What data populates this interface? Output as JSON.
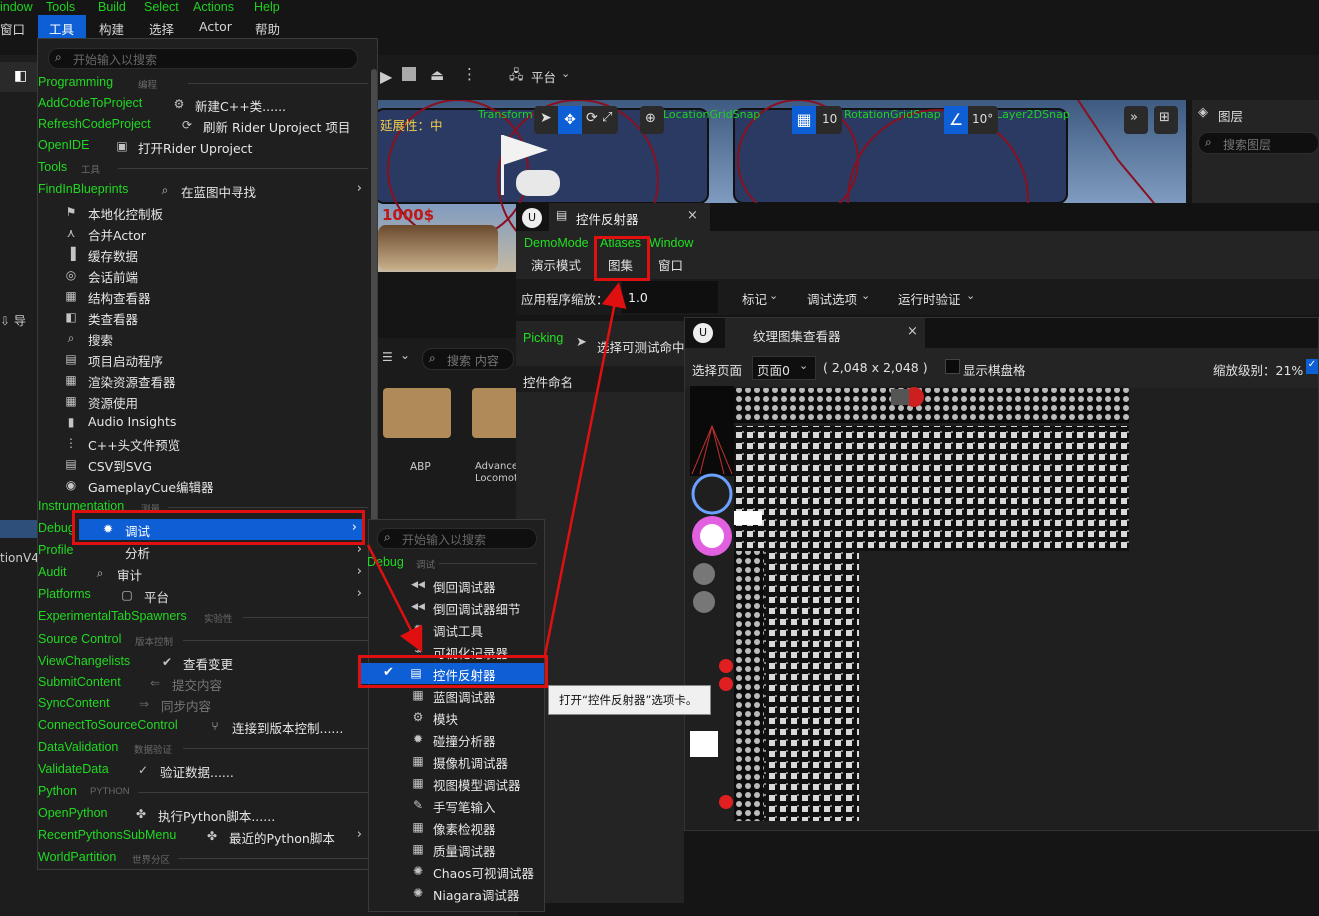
{
  "top_menu": {
    "items": [
      {
        "en": "indow",
        "cn": "窗口"
      },
      {
        "en": "Tools",
        "cn": "工具"
      },
      {
        "en": "Build",
        "cn": "构建"
      },
      {
        "en": "Select",
        "cn": "选择"
      },
      {
        "en": "Actions",
        "cn": "Actor"
      },
      {
        "en": "Help",
        "cn": "帮助"
      }
    ]
  },
  "toolbar": {
    "platform_label": "平台"
  },
  "viewport": {
    "green_labels": [
      "Transform",
      "LocationGridSnap",
      "RotationGridSnap",
      "Layer2DSnap"
    ],
    "snap_value": "10",
    "rot_value": "10°",
    "extensibility": "延展性：中",
    "banner_text": "1000$"
  },
  "layers_panel": {
    "title": "图层",
    "search_placeholder": "搜索图层"
  },
  "content_browser": {
    "search_placeholder": "搜索 内容",
    "folders": [
      "ABP",
      "Advance Locomot"
    ]
  },
  "left_fragments": {
    "import": "导",
    "version": "tionV4"
  },
  "tools_menu": {
    "search_placeholder": "开始输入以搜索",
    "sections": {
      "programming": {
        "en": "Programming",
        "small": "编程"
      },
      "tools": {
        "en": "Tools",
        "small": "工具"
      },
      "instrumentation": {
        "en": "Instrumentation",
        "small": "测量"
      },
      "source_control": {
        "en": "Source Control",
        "small": "版本控制"
      },
      "data_validation": {
        "en": "DataValidation",
        "small": "数据验证"
      },
      "python": {
        "en": "Python",
        "small": "PYTHON"
      },
      "world_partition": {
        "en": "WorldPartition",
        "small": "世界分区"
      },
      "experimental": {
        "en": "ExperimentalTabSpawners",
        "small": "实验性"
      }
    },
    "items": [
      {
        "en": "AddCodeToProject",
        "cn": "新建C++类......",
        "icon": "cpp-class-icon",
        "glyph": "⚙"
      },
      {
        "en": "RefreshCodeProject",
        "cn": "刷新 Rider Uproject 项目",
        "icon": "refresh-icon",
        "glyph": "⟳"
      },
      {
        "en": "OpenIDE",
        "cn": "打开Rider Uproject",
        "icon": "ide-icon",
        "glyph": "▣"
      },
      {
        "en": "FindInBlueprints",
        "cn": "在蓝图中寻找",
        "icon": "search-icon",
        "glyph": "⌕"
      },
      {
        "en": "",
        "cn": "本地化控制板",
        "icon": "flag-icon",
        "glyph": "⚑"
      },
      {
        "en": "",
        "cn": "合并Actor",
        "icon": "merge-icon",
        "glyph": "⋏"
      },
      {
        "en": "",
        "cn": "缓存数据",
        "icon": "chart-icon",
        "glyph": "▐"
      },
      {
        "en": "",
        "cn": "会话前端",
        "icon": "session-icon",
        "glyph": "◎"
      },
      {
        "en": "",
        "cn": "结构查看器",
        "icon": "struct-icon",
        "glyph": "▦"
      },
      {
        "en": "",
        "cn": "类查看器",
        "icon": "class-icon",
        "glyph": "◧"
      },
      {
        "en": "",
        "cn": "搜索",
        "icon": "search-icon",
        "glyph": "⌕"
      },
      {
        "en": "",
        "cn": "项目启动程序",
        "icon": "launcher-icon",
        "glyph": "▤"
      },
      {
        "en": "",
        "cn": "渲染资源查看器",
        "icon": "render-icon",
        "glyph": "▦"
      },
      {
        "en": "",
        "cn": "资源使用",
        "icon": "table-icon",
        "glyph": "▦"
      },
      {
        "en": "",
        "cn": "Audio Insights",
        "icon": "audio-icon",
        "glyph": "▮"
      },
      {
        "en": "",
        "cn": "C++头文件预览",
        "icon": "header-icon",
        "glyph": "⋮"
      },
      {
        "en": "",
        "cn": "CSV到SVG",
        "icon": "csv-icon",
        "glyph": "▤"
      },
      {
        "en": "",
        "cn": "GameplayCue编辑器",
        "icon": "cue-icon",
        "glyph": "◉"
      },
      {
        "en": "Debug",
        "cn": "调试",
        "icon": "debug-icon",
        "glyph": "✹"
      },
      {
        "en": "Profile",
        "cn": "分析",
        "icon": "",
        "glyph": ""
      },
      {
        "en": "Audit",
        "cn": "审计",
        "icon": "audit-icon",
        "glyph": "⌕"
      },
      {
        "en": "Platforms",
        "cn": "平台",
        "icon": "platform-icon",
        "glyph": "▢"
      },
      {
        "en": "ViewChangelists",
        "cn": "查看变更",
        "icon": "check-circle-icon",
        "glyph": "✔"
      },
      {
        "en": "SubmitContent",
        "cn": "提交内容",
        "icon": "submit-icon",
        "glyph": "⇐"
      },
      {
        "en": "SyncContent",
        "cn": "同步内容",
        "icon": "sync-icon",
        "glyph": "⇒"
      },
      {
        "en": "ConnectToSourceControl",
        "cn": "连接到版本控制......",
        "icon": "connect-icon",
        "glyph": "⑂"
      },
      {
        "en": "ValidateData",
        "cn": "验证数据......",
        "icon": "validate-icon",
        "glyph": "✓"
      },
      {
        "en": "OpenPython",
        "cn": "执行Python脚本......",
        "icon": "python-icon",
        "glyph": "✤"
      },
      {
        "en": "RecentPythonsSubMenu",
        "cn": "最近的Python脚本",
        "icon": "python-icon",
        "glyph": "✤"
      }
    ]
  },
  "debug_submenu": {
    "search_placeholder": "开始输入以搜索",
    "header_en": "Debug",
    "header_small": "调试",
    "items": [
      {
        "cn": "倒回调试器",
        "icon": "rewind-icon",
        "glyph": "◀◀"
      },
      {
        "cn": "倒回调试器细节",
        "icon": "rewind-icon",
        "glyph": "◀◀"
      },
      {
        "cn": "调试工具",
        "icon": "debug-tool-icon",
        "glyph": "✹"
      },
      {
        "cn": "可视化记录器",
        "icon": "logger-icon",
        "glyph": "⌁"
      },
      {
        "cn": "控件反射器",
        "icon": "reflector-icon",
        "glyph": "▤"
      },
      {
        "cn": "蓝图调试器",
        "icon": "blueprint-debug-icon",
        "glyph": "▦"
      },
      {
        "cn": "模块",
        "icon": "module-icon",
        "glyph": "⚙"
      },
      {
        "cn": "碰撞分析器",
        "icon": "collision-icon",
        "glyph": "✹"
      },
      {
        "cn": "摄像机调试器",
        "icon": "camera-icon",
        "glyph": "▦"
      },
      {
        "cn": "视图模型调试器",
        "icon": "viewmodel-icon",
        "glyph": "▦"
      },
      {
        "cn": "手写笔输入",
        "icon": "stylus-icon",
        "glyph": "✎"
      },
      {
        "cn": "像素检视器",
        "icon": "pixel-icon",
        "glyph": "▦"
      },
      {
        "cn": "质量调试器",
        "icon": "quality-icon",
        "glyph": "▦"
      },
      {
        "cn": "Chaos可视调试器",
        "icon": "chaos-icon",
        "glyph": "✺"
      },
      {
        "cn": "Niagara调试器",
        "icon": "niagara-icon",
        "glyph": "✺"
      }
    ],
    "tooltip": "打开“控件反射器”选项卡。"
  },
  "widget_reflector": {
    "tab_title": "控件反射器",
    "menus": [
      {
        "en": "DemoMode",
        "cn": "演示模式"
      },
      {
        "en": "Atlases",
        "cn": "图集"
      },
      {
        "en": "Window",
        "cn": "窗口"
      }
    ],
    "app_scale_label": "应用程序缩放：",
    "app_scale_value": "1.0",
    "toolbar": [
      "标记",
      "调试选项",
      "运行时验证"
    ],
    "picking_label": "Picking",
    "picking_action": "选择可测试命中",
    "column_widget_name": "控件命名"
  },
  "atlas_viewer": {
    "tab_title": "纹理图集查看器",
    "page_label": "选择页面",
    "page_value": "页面0",
    "page_size": "( 2,048 x 2,048 )",
    "checkerboard_label": "显示棋盘格",
    "zoom_label": "缩放级别：21%"
  },
  "colors": {
    "accent": "#0e5fd6",
    "highlight_red": "#e01010",
    "green_label": "#21d921",
    "menu_bg": "#1f1f1f"
  }
}
